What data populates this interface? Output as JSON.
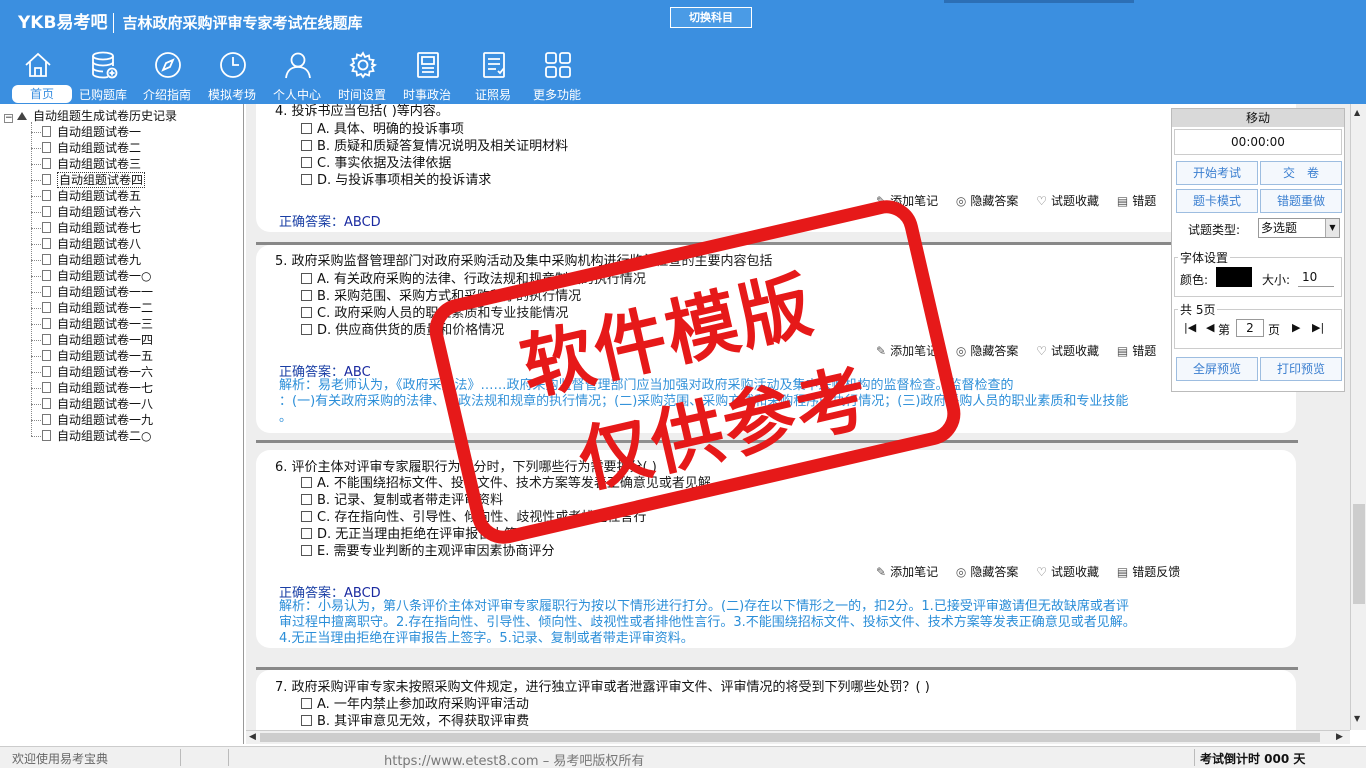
{
  "header": {
    "logo": "YKB易考吧",
    "title": "吉林政府采购评审专家考试在线题库",
    "switch_subject": "切换科目"
  },
  "nav": [
    {
      "label": "首页",
      "icon": "home-icon"
    },
    {
      "label": "已购题库",
      "icon": "database-icon"
    },
    {
      "label": "介绍指南",
      "icon": "compass-icon"
    },
    {
      "label": "模拟考场",
      "icon": "clock-icon"
    },
    {
      "label": "个人中心",
      "icon": "user-icon"
    },
    {
      "label": "时间设置",
      "icon": "gear-icon"
    },
    {
      "label": "时事政治",
      "icon": "newspaper-icon"
    },
    {
      "label": "证照易",
      "icon": "document-list-icon"
    },
    {
      "label": "更多功能",
      "icon": "grid-icon"
    }
  ],
  "tree": {
    "root": "自动组题生成试卷历史记录",
    "items": [
      "自动组题试卷一",
      "自动组题试卷二",
      "自动组题试卷三",
      "自动组题试卷四",
      "自动组题试卷五",
      "自动组题试卷六",
      "自动组题试卷七",
      "自动组题试卷八",
      "自动组题试卷九",
      "自动组题试卷一○",
      "自动组题试卷一一",
      "自动组题试卷一二",
      "自动组题试卷一三",
      "自动组题试卷一四",
      "自动组题试卷一五",
      "自动组题试卷一六",
      "自动组题试卷一七",
      "自动组题试卷一八",
      "自动组题试卷一九",
      "自动组题试卷二○"
    ],
    "selected_index": 3
  },
  "actions": {
    "note": "添加笔记",
    "hide": "隐藏答案",
    "fav": "试题收藏",
    "error": "错题反馈",
    "error_short": "错题"
  },
  "questions": {
    "q4": {
      "stem": "4. 投诉书应当包括( )等内容。",
      "options": [
        "A. 具体、明确的投诉事项",
        "B. 质疑和质疑答复情况说明及相关证明材料",
        "C. 事实依据及法律依据",
        "D. 与投诉事项相关的投诉请求"
      ],
      "answer_label": "正确答案：",
      "answer": "ABCD"
    },
    "q5": {
      "stem": "5. 政府采购监督管理部门对政府采购活动及集中采购机构进行监督检查的主要内容包括",
      "options": [
        "A. 有关政府采购的法律、行政法规和规章制度的执行情况",
        "B. 采购范围、采购方式和采购程序的执行情况",
        "C. 政府采购人员的职业素质和专业技能情况",
        "D. 供应商供货的质量和价格情况"
      ],
      "answer_label": "正确答案：",
      "answer": "ABC",
      "analysis_1": "解析：易老师认为，《政府采购法》……政府采购监督管理部门应当加强对政府采购活动及集中采购机构的监督检查。监督检查的",
      "analysis_2": "：(一)有关政府采购的法律、行政法规和规章的执行情况；(二)采购范围、采购方式和采购程序的执行情况；(三)政府采购人员的职业素质和专业技能",
      "analysis_3": "。"
    },
    "q6": {
      "stem": "6. 评价主体对评审专家履职行为评分时，下列哪些行为需要扣分( )",
      "options": [
        "A. 不能围绕招标文件、投标文件、技术方案等发表正确意见或者见解",
        "B. 记录、复制或者带走评审资料",
        "C. 存在指向性、引导性、倾向性、歧视性或者排他性言行",
        "D. 无正当理由拒绝在评审报告上签字",
        "E. 需要专业判断的主观评审因素协商评分"
      ],
      "answer_label": "正确答案：",
      "answer": "ABCD",
      "analysis_1": "解析：小易认为，第八条评价主体对评审专家履职行为按以下情形进行打分。(二)存在以下情形之一的，扣2分。1.已接受评审邀请但无故缺席或者评",
      "analysis_2": "审过程中擅离职守。2.存在指向性、引导性、倾向性、歧视性或者排他性言行。3.不能围绕招标文件、投标文件、技术方案等发表正确意见或者见解。",
      "analysis_3": "4.无正当理由拒绝在评审报告上签字。5.记录、复制或者带走评审资料。"
    },
    "q7": {
      "stem": "7. 政府采购评审专家未按照采购文件规定，进行独立评审或者泄露评审文件、评审情况的将受到下列哪些处罚？( )",
      "options": [
        "A. 一年内禁止参加政府采购评审活动",
        "B. 其评审意见无效，不得获取评审费"
      ]
    }
  },
  "panel": {
    "move": "移动",
    "timer": "00:00:00",
    "start_exam": "开始考试",
    "submit": "交　卷",
    "card_mode": "题卡模式",
    "redo_wrong": "错题重做",
    "type_label": "试题类型:",
    "type_value": "多选题",
    "font_group": "字体设置",
    "color_label": "颜色:",
    "font_color": "#000000",
    "size_label": "大小:",
    "size_value": "10",
    "pages_label": "共 5页",
    "page_prefix": "第",
    "page_value": "2",
    "page_suffix": "页",
    "fullscreen": "全屏预览",
    "print": "打印预览"
  },
  "status": {
    "welcome": "欢迎使用易考宝典",
    "copyright": "https://www.etest8.com – 易考吧版权所有",
    "countdown": "考试倒计时 000 天"
  },
  "watermark": {
    "line1": "软件模版",
    "line2": "仅供参考"
  },
  "colors": {
    "header": "#3b8fe0",
    "answer": "#1a3fa5",
    "analysis": "#2b8ed8",
    "watermark": "#e61919"
  }
}
